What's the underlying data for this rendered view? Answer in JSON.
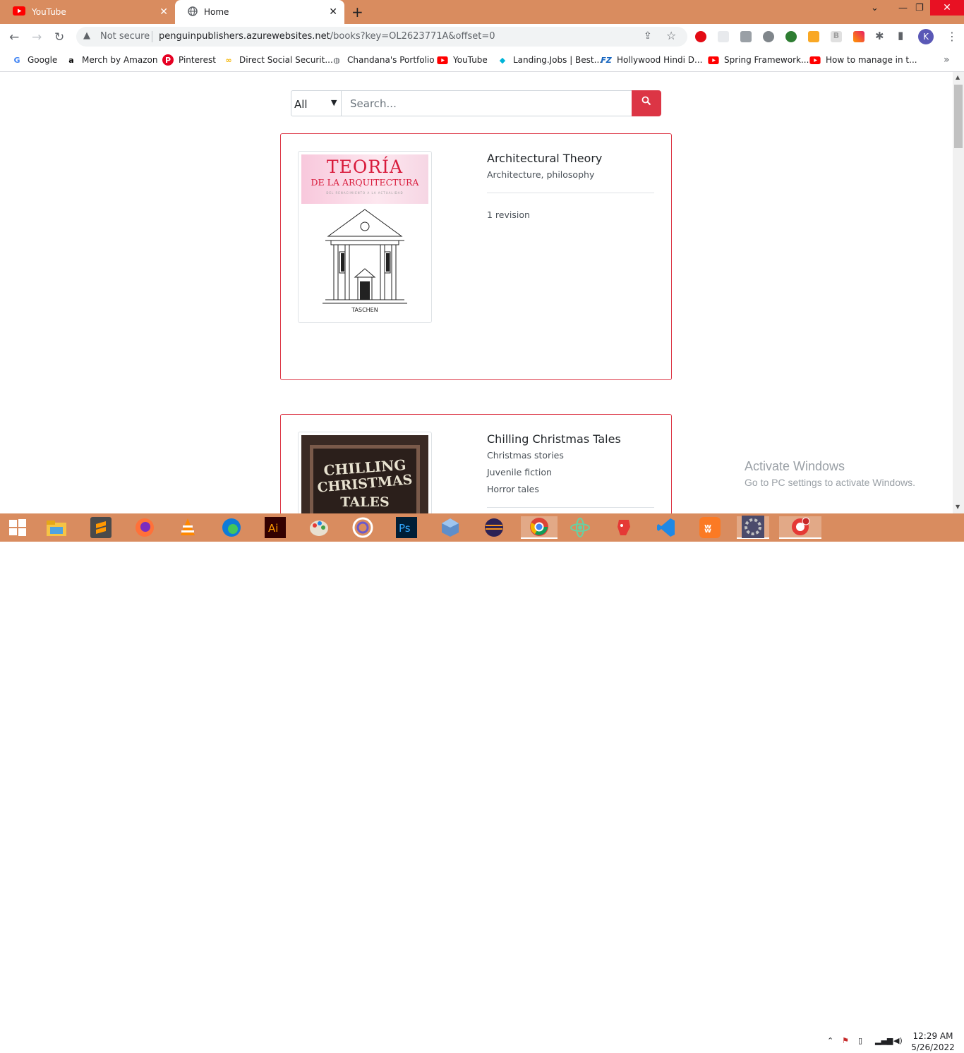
{
  "tabs": [
    {
      "title": "YouTube",
      "icon": "youtube-icon"
    },
    {
      "title": "Home",
      "icon": "globe-icon"
    }
  ],
  "address": {
    "security": "Not secure",
    "host": "penguinpublishers.azurewebsites.net",
    "path": "/books?key=OL2623771A&offset=0"
  },
  "profile_initial": "K",
  "bookmarks": [
    {
      "label": "Google",
      "icon": "google-icon",
      "color": "#4285f4"
    },
    {
      "label": "Merch by Amazon",
      "icon": "amazon-icon",
      "color": "#000000"
    },
    {
      "label": "Pinterest",
      "icon": "pinterest-icon",
      "color": "#e60023"
    },
    {
      "label": "Direct Social Securit...",
      "icon": "link-icon",
      "color": "#f4b400"
    },
    {
      "label": "Chandana's Portfolio",
      "icon": "globe-icon",
      "color": "#5f6368"
    },
    {
      "label": "YouTube",
      "icon": "youtube-icon",
      "color": "#ff0000"
    },
    {
      "label": "Landing.Jobs | Best...",
      "icon": "landingjobs-icon",
      "color": "#00b4d8"
    },
    {
      "label": "Hollywood Hindi D...",
      "icon": "fz-icon",
      "color": "#1565c0"
    },
    {
      "label": "Spring Framework...",
      "icon": "youtube-icon",
      "color": "#ff0000"
    },
    {
      "label": "How to manage in t...",
      "icon": "youtube-icon",
      "color": "#ff0000"
    }
  ],
  "search": {
    "category": "All",
    "placeholder": "Search..."
  },
  "books": [
    {
      "title": "Architectural Theory",
      "subjects": [
        "Architecture, philosophy"
      ],
      "revision": "1 revision",
      "cover": {
        "line1": "TEORÍA",
        "line2": "DE LA ARQUITECTURA",
        "line3": "DEL RENACIMIENTO A LA ACTUALIDAD",
        "publisher": "TASCHEN"
      }
    },
    {
      "title": "Chilling Christmas Tales",
      "subjects": [
        "Christmas stories",
        "Juvenile fiction",
        "Horror tales"
      ],
      "cover": {
        "line1": "CHILLING",
        "line2": "CHRISTMAS",
        "line3": "TALES"
      }
    }
  ],
  "watermark": {
    "title": "Activate Windows",
    "subtitle": "Go to PC settings to activate Windows."
  },
  "clock": {
    "time": "12:29 AM",
    "date": "5/26/2022"
  },
  "colors": {
    "accent": "#dc3545",
    "chrome_frame": "#d98c5f"
  }
}
